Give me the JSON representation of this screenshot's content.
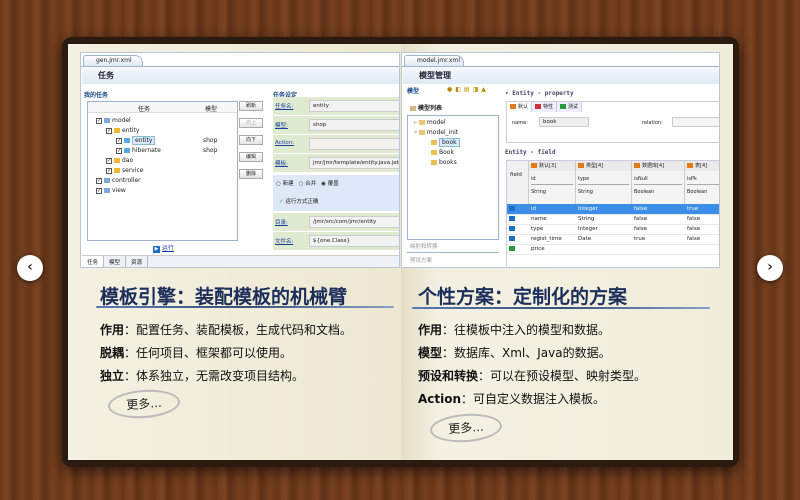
{
  "nav": {
    "prev": "‹",
    "next": "›"
  },
  "left": {
    "editor_tab": "gen.jmr.xml",
    "editor_title": "任务",
    "my_tasks": "我的任务",
    "task_settings": "任务设定",
    "tree_headers": [
      "任务",
      "模型"
    ],
    "tree": [
      {
        "label": "model",
        "model": "",
        "level": 0
      },
      {
        "label": "entity",
        "model": "",
        "level": 1
      },
      {
        "label": "entity",
        "model": "shop",
        "level": 2,
        "selected": true
      },
      {
        "label": "hibernate",
        "model": "shop",
        "level": 2
      },
      {
        "label": "dao",
        "model": "",
        "level": 1
      },
      {
        "label": "service",
        "model": "",
        "level": 1
      },
      {
        "label": "controller",
        "model": "",
        "level": 0
      },
      {
        "label": "view",
        "model": "",
        "level": 0
      }
    ],
    "buttons": [
      "刷新",
      "向上",
      "向下",
      "编辑",
      "删除"
    ],
    "fields": [
      {
        "label": "任务名:",
        "value": "entity"
      },
      {
        "label": "模型:",
        "value": "shop"
      },
      {
        "label": "Action:",
        "value": ""
      },
      {
        "label": "模板:",
        "value": "jmr/jmr/template/entity.java.jet"
      }
    ],
    "radios": [
      "新建",
      "合并",
      "覆盖"
    ],
    "radio_selected": "覆盖",
    "status": "运行方式正确",
    "fields2": [
      {
        "label": "目录:",
        "value": "/jmr/src/com/jmr/entity"
      },
      {
        "label": "文件名:",
        "value": "${one.Class}"
      }
    ],
    "run": "运行",
    "bottom_tabs": [
      "任务",
      "模型",
      "资源"
    ],
    "heading": "模板引擎：装配模板的机械臂",
    "lines": [
      {
        "key": "作用",
        "text": "：配置任务、装配模板，生成代码和文档。"
      },
      {
        "key": "脱耦",
        "text": "：任何项目、框架都可以使用。"
      },
      {
        "key": "独立",
        "text": "：体系独立，无需改变项目结构。"
      }
    ],
    "more": "更多..."
  },
  "right": {
    "editor_tab": "model.jmr.xml",
    "editor_title": "模型管理",
    "model_label": "模型",
    "model_list": "模型列表",
    "tree": [
      {
        "label": "model",
        "level": 0
      },
      {
        "label": "model_init",
        "level": 0
      },
      {
        "label": "book",
        "level": 1,
        "selected": true
      },
      {
        "label": "Book",
        "level": 1
      },
      {
        "label": "books",
        "level": 1
      }
    ],
    "mapping": "映射和转换",
    "presets": "预设方案",
    "property_title": "▾ Entity - property",
    "property_tabs": [
      "默认",
      "特性",
      "测试"
    ],
    "name_label": "name:",
    "name_value": "book",
    "relation_label": "relation:",
    "field_title": "Entity - field",
    "groups": [
      "默认[3]",
      "类型[4]",
      "数据库[4]",
      "表[4]"
    ],
    "field_label": "field",
    "columns": [
      {
        "name": "id",
        "type": "String"
      },
      {
        "name": "type",
        "type": "String"
      },
      {
        "name": "isNull",
        "type": "Boolean"
      },
      {
        "name": "isPk",
        "type": "Boolean"
      }
    ],
    "rows": [
      [
        "id",
        "Integer",
        "false",
        "true"
      ],
      [
        "name",
        "String",
        "false",
        "false"
      ],
      [
        "type",
        "Integer",
        "false",
        "false"
      ],
      [
        "regist_time",
        "Date",
        "true",
        "false"
      ],
      [
        "price",
        "",
        "",
        ""
      ]
    ],
    "heading": "个性方案：定制化的方案",
    "lines": [
      {
        "key": "作用",
        "text": "：往模板中注入的模型和数据。"
      },
      {
        "key": "模型",
        "text": "：数据库、Xml、Java的数据。"
      },
      {
        "key": "预设和转换",
        "text": "：可以在预设模型、映射类型。"
      },
      {
        "key": "Action",
        "text": "：可自定义数据注入模板。"
      }
    ],
    "more": "更多..."
  },
  "colors": {
    "accent": "#1c2e5a",
    "selection": "#3c8ee6",
    "wood": "#6e3a1c",
    "page": "#f3f0e0"
  }
}
